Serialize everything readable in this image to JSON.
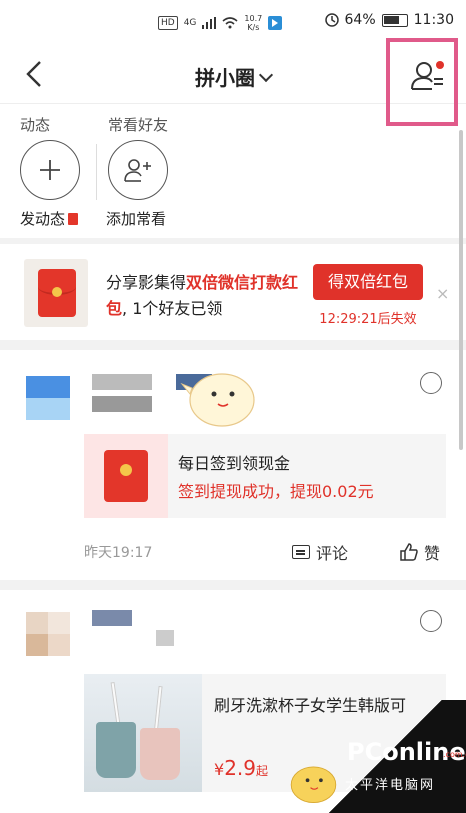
{
  "status_bar": {
    "hd": "HD",
    "network": "4G",
    "speed_value": "10.7",
    "speed_unit": "K/s",
    "battery": "64%",
    "time": "11:30"
  },
  "nav": {
    "title": "拼小圈"
  },
  "tabs": {
    "moments_label": "动态",
    "friends_label": "常看好友",
    "post_label": "发动态",
    "add_label": "添加常看"
  },
  "promo": {
    "text_prefix": "分享影集得",
    "text_red": "双倍微信打款红包",
    "text_suffix": ", 1个好友已领",
    "button": "得双倍红包",
    "timer": "12:29:21后失效",
    "close": "×"
  },
  "post1": {
    "card_title": "每日签到领现金",
    "card_sub": "签到提现成功，提现0.02元",
    "time": "昨天19:17",
    "comment_label": "评论",
    "like_label": "赞"
  },
  "post2": {
    "product_title": "刷牙洗漱杯子女学生韩版可",
    "price_symbol": "¥",
    "price_value": "2.9",
    "price_suffix": "起"
  },
  "watermark": {
    "logo": "PConline",
    "dot": ".com.cn",
    "cn": "太平洋电脑网"
  },
  "colors": {
    "accent_red": "#e0322a",
    "highlight_pink": "#e05a8a"
  }
}
